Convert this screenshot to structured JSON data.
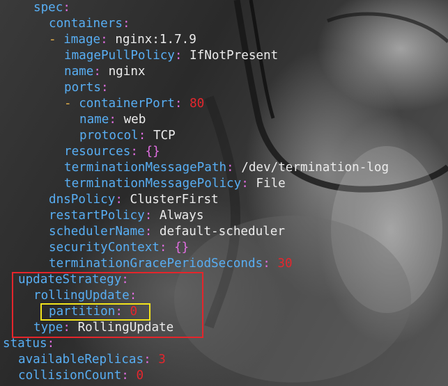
{
  "yaml": {
    "spec_key": "spec",
    "containers_key": "containers",
    "image_key": "image",
    "image_value": "nginx:1.7.9",
    "image_pull_policy_key": "imagePullPolicy",
    "image_pull_policy_value": "IfNotPresent",
    "name_key": "name",
    "name_value": "nginx",
    "ports_key": "ports",
    "container_port_key": "containerPort",
    "container_port_value": "80",
    "port_name_key": "name",
    "port_name_value": "web",
    "protocol_key": "protocol",
    "protocol_value": "TCP",
    "resources_key": "resources",
    "resources_value": "{}",
    "termination_message_path_key": "terminationMessagePath",
    "termination_message_path_value": "/dev/termination-log",
    "termination_message_policy_key": "terminationMessagePolicy",
    "termination_message_policy_value": "File",
    "dns_policy_key": "dnsPolicy",
    "dns_policy_value": "ClusterFirst",
    "restart_policy_key": "restartPolicy",
    "restart_policy_value": "Always",
    "scheduler_name_key": "schedulerName",
    "scheduler_name_value": "default-scheduler",
    "security_context_key": "securityContext",
    "security_context_value": "{}",
    "termination_grace_key": "terminationGracePeriodSeconds",
    "termination_grace_value": "30",
    "update_strategy_key": "updateStrategy",
    "rolling_update_key": "rollingUpdate",
    "partition_key": "partition",
    "partition_value": "0",
    "type_key": "type",
    "type_value": "RollingUpdate",
    "status_key": "status",
    "available_replicas_key": "availableReplicas",
    "available_replicas_value": "3",
    "collision_count_key": "collisionCount",
    "collision_count_value": "0"
  },
  "colors": {
    "key": "#58aef3",
    "colon": "#e26ee2",
    "dash": "#e6b14a",
    "value": "#ececec",
    "number": "#e5262d",
    "highlight_red": "#e5252b",
    "highlight_yellow": "#f2e31c"
  }
}
